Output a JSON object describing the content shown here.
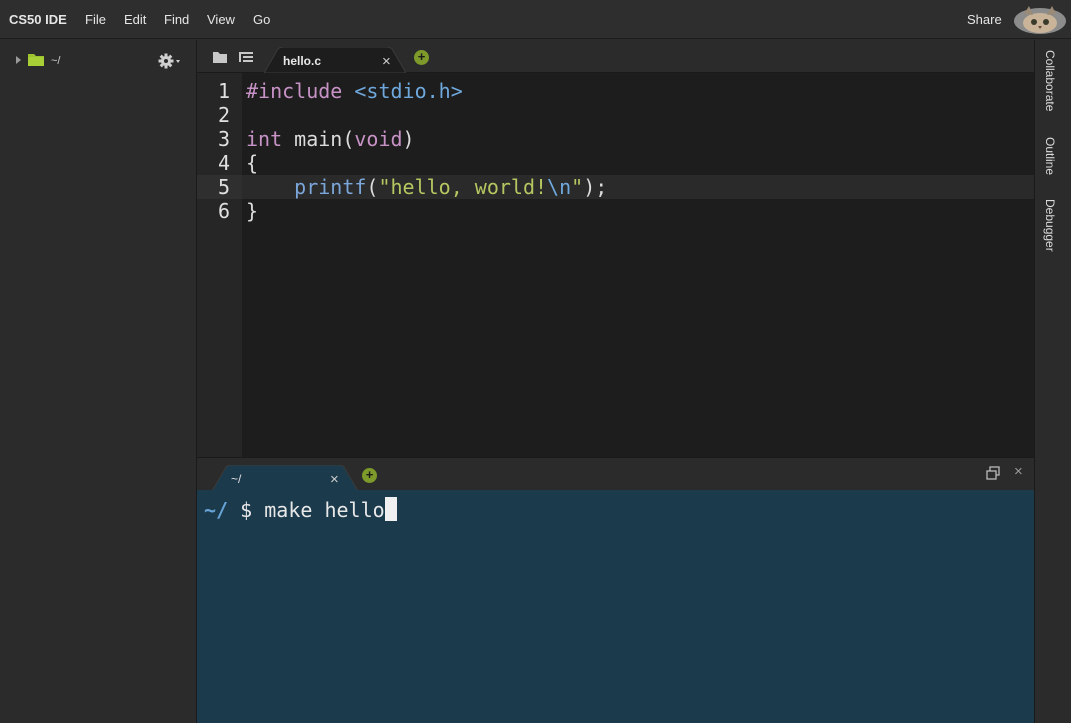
{
  "menubar": {
    "brand": "CS50 IDE",
    "items": [
      {
        "label": "File"
      },
      {
        "label": "Edit"
      },
      {
        "label": "Find"
      },
      {
        "label": "View"
      },
      {
        "label": "Go"
      }
    ],
    "share_label": "Share",
    "avatar_icon": "cat-avatar-icon"
  },
  "workspace": {
    "root_label": "~/",
    "folder_color": "#9ec22f",
    "settings_icon": "gear-icon"
  },
  "editor": {
    "tab_label": "hello.c",
    "tab_close": "×",
    "add_tab": "+",
    "active_line": 5,
    "line_numbers": [
      "1",
      "2",
      "3",
      "4",
      "5",
      "6"
    ],
    "lines": [
      {
        "seg": [
          "#include",
          " ",
          "<stdio.h>"
        ]
      },
      {
        "seg": []
      },
      {
        "seg": [
          "int",
          " main(",
          "void",
          ")"
        ]
      },
      {
        "seg": [
          "{"
        ]
      },
      {
        "seg": [
          "    ",
          "printf",
          "(",
          "\"hello, world!",
          "\\n",
          "\"",
          ");"
        ]
      },
      {
        "seg": [
          "}"
        ]
      }
    ]
  },
  "terminal": {
    "tab_label": "~/",
    "tab_close": "×",
    "add_tab": "+",
    "prompt_dir": "~/",
    "prompt_symbol": "$",
    "command": "make hello",
    "close_label": "×"
  },
  "right_panel": {
    "tabs": [
      {
        "label": "Collaborate"
      },
      {
        "label": "Outline"
      },
      {
        "label": "Debugger"
      }
    ]
  },
  "colors": {
    "accent_green": "#7d9a2a",
    "terminal_bg": "#1b3a4c",
    "editor_bg": "#1d1d1d"
  }
}
